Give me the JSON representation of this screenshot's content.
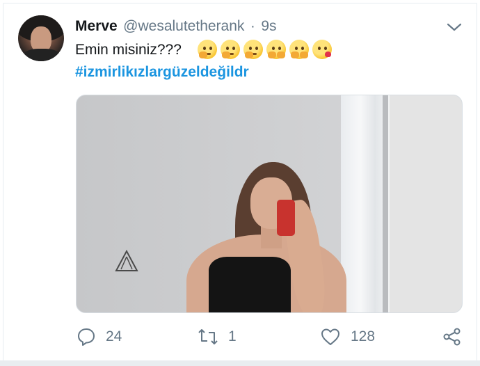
{
  "tweet": {
    "display_name": "Merve",
    "handle": "@wesalutetherank",
    "separator": "·",
    "time": "9s",
    "text": "Emin misiniz???",
    "emojis": [
      "thinking-face",
      "thinking-face",
      "thinking-face",
      "hugging-face",
      "hugging-face",
      "face-blowing-a-kiss"
    ],
    "hashtag": "#izmirlikızlargüzeldeğildr"
  },
  "actions": {
    "reply_count": "24",
    "retweet_count": "1",
    "like_count": "128"
  },
  "colors": {
    "link": "#1b95e0",
    "secondary_text": "#657786",
    "primary_text": "#14171a"
  }
}
